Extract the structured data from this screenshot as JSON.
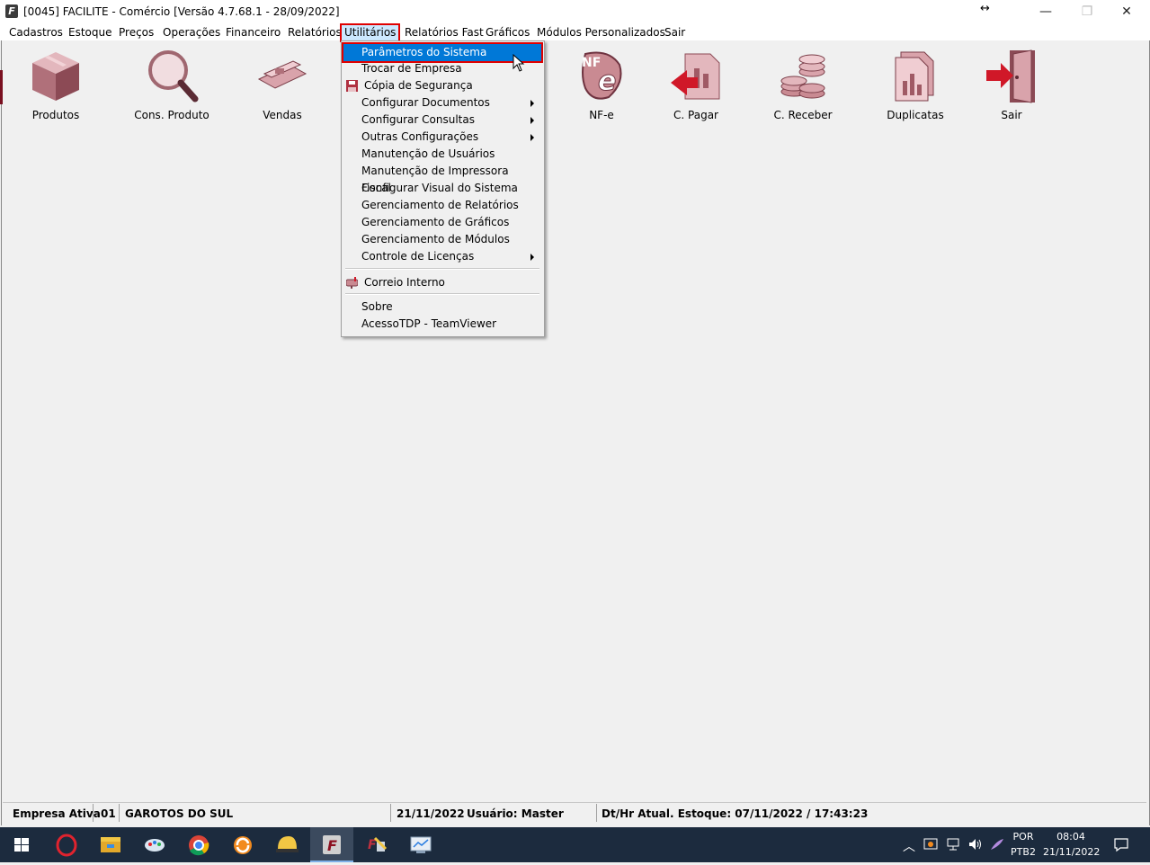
{
  "window": {
    "title": "[0045] FACILITE - Comércio [Versão 4.7.68.1 - 28/09/2022]",
    "app_icon": "F",
    "controls": {
      "minimize": "—",
      "maximize": "❐",
      "close": "✕",
      "resize": "↔"
    }
  },
  "menubar": [
    "Cadastros",
    "Estoque",
    "Preços",
    "Operações",
    "Financeiro",
    "Relatórios",
    "Utilitários",
    "Relatórios Fast",
    "Gráficos",
    "Módulos Personalizados",
    "Sair"
  ],
  "active_menu": "Utilitários",
  "toolbar": [
    {
      "label": "Produtos",
      "icon": "box-icon"
    },
    {
      "label": "Cons. Produto",
      "icon": "magnifier-icon"
    },
    {
      "label": "Vendas",
      "icon": "cash-icon"
    },
    {
      "label": "NF-e",
      "icon": "nfe-icon"
    },
    {
      "label": "C. Pagar",
      "icon": "pay-icon"
    },
    {
      "label": "C. Receber",
      "icon": "coins-icon"
    },
    {
      "label": "Duplicatas",
      "icon": "documents-icon"
    },
    {
      "label": "Sair",
      "icon": "exit-door-icon"
    }
  ],
  "utilities_menu": {
    "items": [
      {
        "label": "Parâmetros do Sistema",
        "highlighted": true
      },
      {
        "label": "Trocar de Empresa"
      },
      {
        "label": "Cópia de Segurança",
        "icon": "floppy-disk-icon"
      },
      {
        "label": "Configurar Documentos",
        "submenu": true
      },
      {
        "label": "Configurar Consultas",
        "submenu": true
      },
      {
        "label": "Outras Configurações",
        "submenu": true
      },
      {
        "label": "Manutenção de Usuários"
      },
      {
        "label": "Manutenção de Impressora Fiscal"
      },
      {
        "label": "Configurar Visual do Sistema"
      },
      {
        "label": "Gerenciamento de Relatórios"
      },
      {
        "label": "Gerenciamento de Gráficos"
      },
      {
        "label": "Gerenciamento de Módulos"
      },
      {
        "label": "Controle de Licenças",
        "submenu": true
      },
      {
        "label": "Correio Interno",
        "icon": "mailbox-icon"
      },
      {
        "label": "Sobre"
      },
      {
        "label": "AcessoTDP - TeamViewer"
      }
    ]
  },
  "statusbar": {
    "company_label": "Empresa Ativa",
    "company_code": "01",
    "company_name": "GAROTOS DO SUL",
    "date": "21/11/2022",
    "user": "Usuário: Master",
    "stock_datetime": "Dt/Hr Atual. Estoque: 07/11/2022 / 17:43:23"
  },
  "taskbar": {
    "language": "POR",
    "layout": "PTB2",
    "time": "08:04",
    "date": "21/11/2022"
  },
  "colors": {
    "highlight": "#0078d7",
    "annotation_red": "#e00000",
    "icon_pink": "#c98a92",
    "taskbar_bg": "#1c2b3e"
  }
}
